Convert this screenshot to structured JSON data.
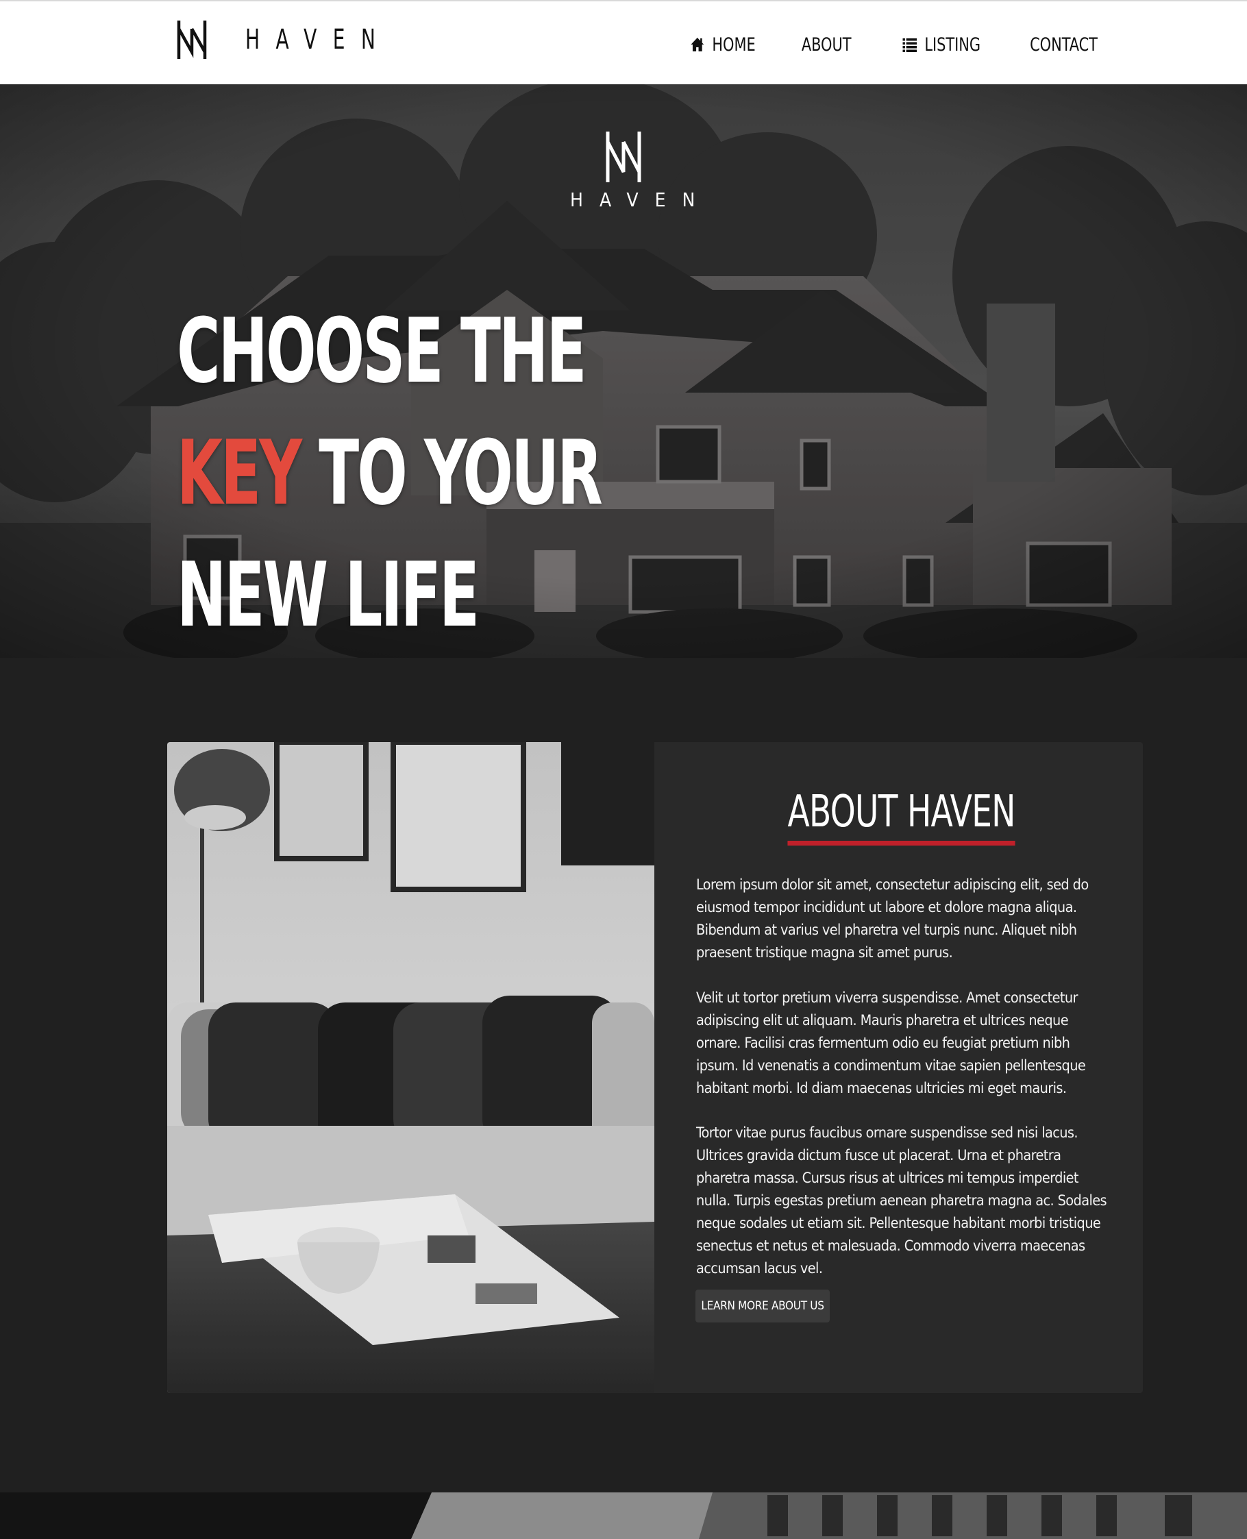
{
  "brand": {
    "name": "HAVEN",
    "logo_icon": "haven-w-logo-icon"
  },
  "nav": {
    "items": [
      {
        "label": "HOME",
        "icon": "home-icon"
      },
      {
        "label": "ABOUT"
      },
      {
        "label": "LISTING",
        "icon": "list-icon"
      },
      {
        "label": "CONTACT"
      }
    ]
  },
  "hero": {
    "logo_text": "HAVEN",
    "title_line1": "CHOOSE THE",
    "title_line2_accent": "KEY",
    "title_line2_rest": " TO YOUR",
    "title_line3": "NEW LIFE"
  },
  "about": {
    "title": "ABOUT HAVEN",
    "paragraphs": [
      "Lorem ipsum dolor sit amet, consectetur adipiscing elit, sed do eiusmod tempor incididunt ut labore et dolore magna aliqua. Bibendum at varius vel pharetra vel turpis nunc. Aliquet nibh praesent tristique magna sit amet purus.",
      "Velit ut tortor pretium viverra suspendisse. Amet consectetur adipiscing elit ut aliquam. Mauris pharetra et ultrices neque ornare. Facilisi cras fermentum odio eu feugiat pretium nibh ipsum. Id venenatis a condimentum vitae sapien pellentesque habitant morbi. Id diam maecenas ultricies mi eget mauris.",
      "Tortor vitae purus faucibus ornare suspendisse sed nisi lacus. Ultrices gravida dictum fusce ut placerat. Urna et pharetra pharetra massa. Cursus risus at ultrices mi tempus imperdiet nulla. Turpis egestas pretium aenean pharetra magna ac. Sodales neque sodales ut etiam sit. Pellentesque habitant morbi tristique senectus et netus et malesuada. Commodo viverra maecenas accumsan lacus vel."
    ],
    "button_label": "LEARN MORE ABOUT US"
  },
  "colors": {
    "accent": "#e34a3d",
    "underline": "#c0202a",
    "page_bg": "#202020",
    "card_bg": "#292929",
    "header_bg": "#ffffff"
  }
}
